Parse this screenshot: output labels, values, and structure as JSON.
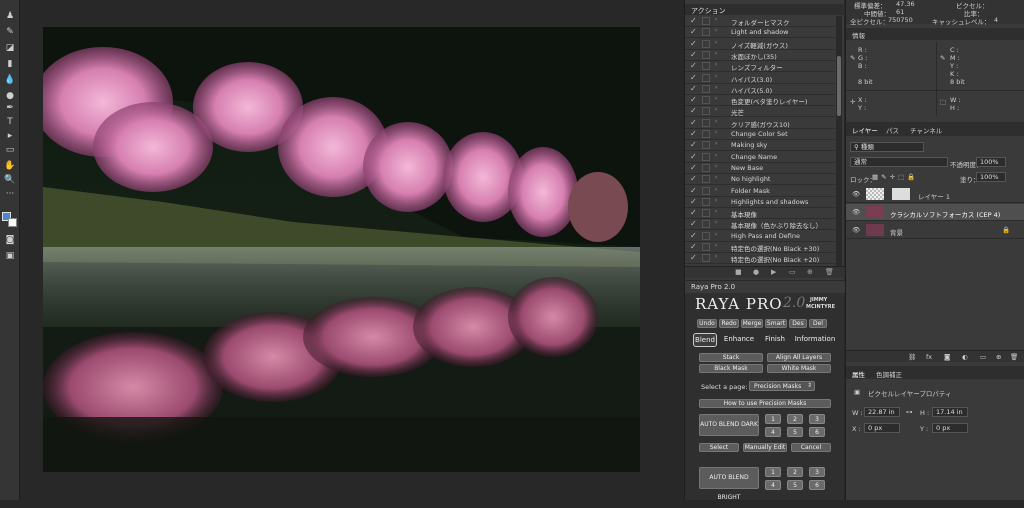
{
  "toolbar": {
    "icons": [
      "stamp-icon",
      "history-brush-icon",
      "eraser-icon",
      "gradient-icon",
      "blur-icon",
      "dodge-icon",
      "pen-icon",
      "type-icon",
      "path-select-icon",
      "rectangle-icon",
      "hand-icon",
      "zoom-icon",
      "more-icon"
    ]
  },
  "info_top": {
    "line1_a": "標準偏差：",
    "line1_b": "47.36",
    "line1_c": "ピクセル：",
    "line2_a": "中間値：",
    "line2_b": "61",
    "line2_c": "比率：",
    "line3_a": "全ピクセル：",
    "line3_b": "750750",
    "line3_c": "キャッシュレベル：",
    "line3_d": "4"
  },
  "actions": {
    "tab": "アクション",
    "items": [
      "フォルダーヒマスク",
      "Light and shadow",
      "ノイズ軽減(ガウス)",
      "水面ぼかし(35)",
      "レンズフィルター",
      "ハイパス(3.0)",
      "ハイパス(5.0)",
      "色変更(ベタ塗りレイヤー)",
      "光芒",
      "クリア感(ガウス10)",
      "Change Color Set",
      "Making sky",
      "Change Name",
      "New Base",
      "No highlight",
      "Folder Mask",
      "Highlights and shadows",
      "基本現像",
      "基本現像（色かぶり除去なし）",
      "High Pass and Define",
      "特定色の選択(No Black +30)",
      "特定色の選択(No Black +20)"
    ]
  },
  "raya": {
    "tab": "Raya Pro 2.0",
    "logo": "RAYA PRO",
    "version": "2.0",
    "author1": "JIMMY",
    "author2": "MCINTYRE",
    "top_buttons": [
      "Undo",
      "Redo",
      "Merge",
      "Smart",
      "Des",
      "Del"
    ],
    "tabs": [
      "Blend",
      "Enhance",
      "Finish",
      "Information"
    ],
    "stack": "Stack",
    "align": "Align All Layers",
    "black_mask": "Black Mask",
    "white_mask": "White Mask",
    "select_label": "Select a page:",
    "select_value": "Precision Masks",
    "how_to": "How to use Precision Masks",
    "auto_dark": "AUTO BLEND DARK",
    "auto_bright": "AUTO BLEND BRIGHT",
    "select_btn": "Select",
    "manual": "Manually Edit",
    "cancel": "Cancel",
    "nums": [
      "1",
      "2",
      "3",
      "4",
      "5",
      "6"
    ]
  },
  "info_panel": {
    "tab": "情報",
    "r": "R :",
    "g": "G :",
    "b": "B :",
    "c": "C :",
    "m": "M :",
    "y": "Y :",
    "k": "K :",
    "bit1": "8 bit",
    "bit2": "8 bit",
    "x": "X :",
    "y2": "Y :",
    "w": "W :",
    "h": "H :"
  },
  "layers": {
    "tabs": [
      "レイヤー",
      "パス",
      "チャンネル"
    ],
    "filter": "種類",
    "blend": "通常",
    "opacity_label": "不透明度：",
    "opacity": "100%",
    "lock_label": "ロック：",
    "fill_label": "塗り：",
    "fill": "100%",
    "items": [
      "レイヤー 1",
      "クラシカルソフトフォーカス (CEP 4)",
      "背景"
    ]
  },
  "properties": {
    "tabs": [
      "属性",
      "色調補正"
    ],
    "title": "ピクセルレイヤープロパティ",
    "w_label": "W :",
    "w": "22.87 in",
    "h_label": "H :",
    "h": "17.14 in",
    "x_label": "X :",
    "x": "0 px",
    "y_label": "Y :",
    "y": "0 px"
  },
  "colors": {
    "panel_bg": "#3a3a3a",
    "app_bg": "#282828",
    "toolbar_bg": "#353535",
    "accent": "#4a86d8"
  }
}
